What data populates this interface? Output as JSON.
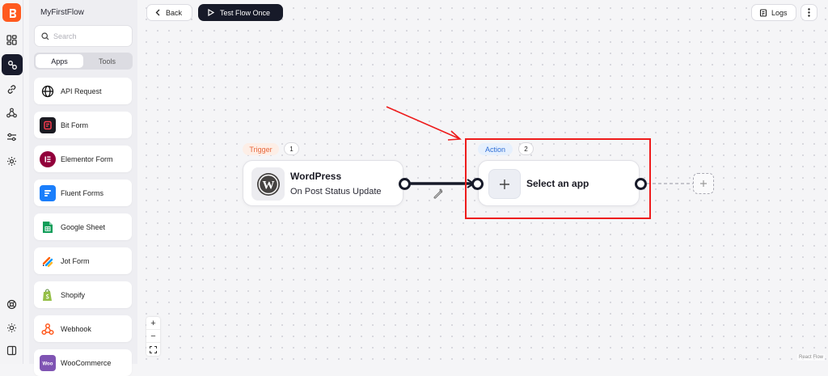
{
  "sidebar": {
    "flow_name": "MyFirstFlow",
    "search_placeholder": "Search",
    "tabs": [
      {
        "label": "Apps",
        "active": true
      },
      {
        "label": "Tools",
        "active": false
      }
    ],
    "apps": [
      {
        "label": "API Request",
        "icon": "globe-icon"
      },
      {
        "label": "Bit Form",
        "icon": "bit-form-icon"
      },
      {
        "label": "Elementor Form",
        "icon": "elementor-icon"
      },
      {
        "label": "Fluent Forms",
        "icon": "fluent-forms-icon"
      },
      {
        "label": "Google Sheet",
        "icon": "google-sheet-icon"
      },
      {
        "label": "Jot Form",
        "icon": "jotform-icon"
      },
      {
        "label": "Shopify",
        "icon": "shopify-icon"
      },
      {
        "label": "Webhook",
        "icon": "webhook-icon"
      },
      {
        "label": "WooCommerce",
        "icon": "woocommerce-icon"
      }
    ]
  },
  "toolbar": {
    "back_label": "Back",
    "test_label": "Test Flow Once",
    "logs_label": "Logs"
  },
  "flow": {
    "trigger": {
      "tag": "Trigger",
      "step": "1",
      "title": "WordPress",
      "subtitle": "On Post Status Update",
      "icon": "wordpress-icon"
    },
    "action": {
      "tag": "Action",
      "step": "2",
      "title": "Select an app",
      "icon": "plus-icon"
    }
  },
  "footer": {
    "attribution": "React Flow"
  },
  "colors": {
    "brand": "#ff5a1f",
    "dark": "#171a29",
    "trigger_tag": "#e8663a",
    "action_tag": "#2f6fd6",
    "highlight": "#ee1b1b"
  }
}
